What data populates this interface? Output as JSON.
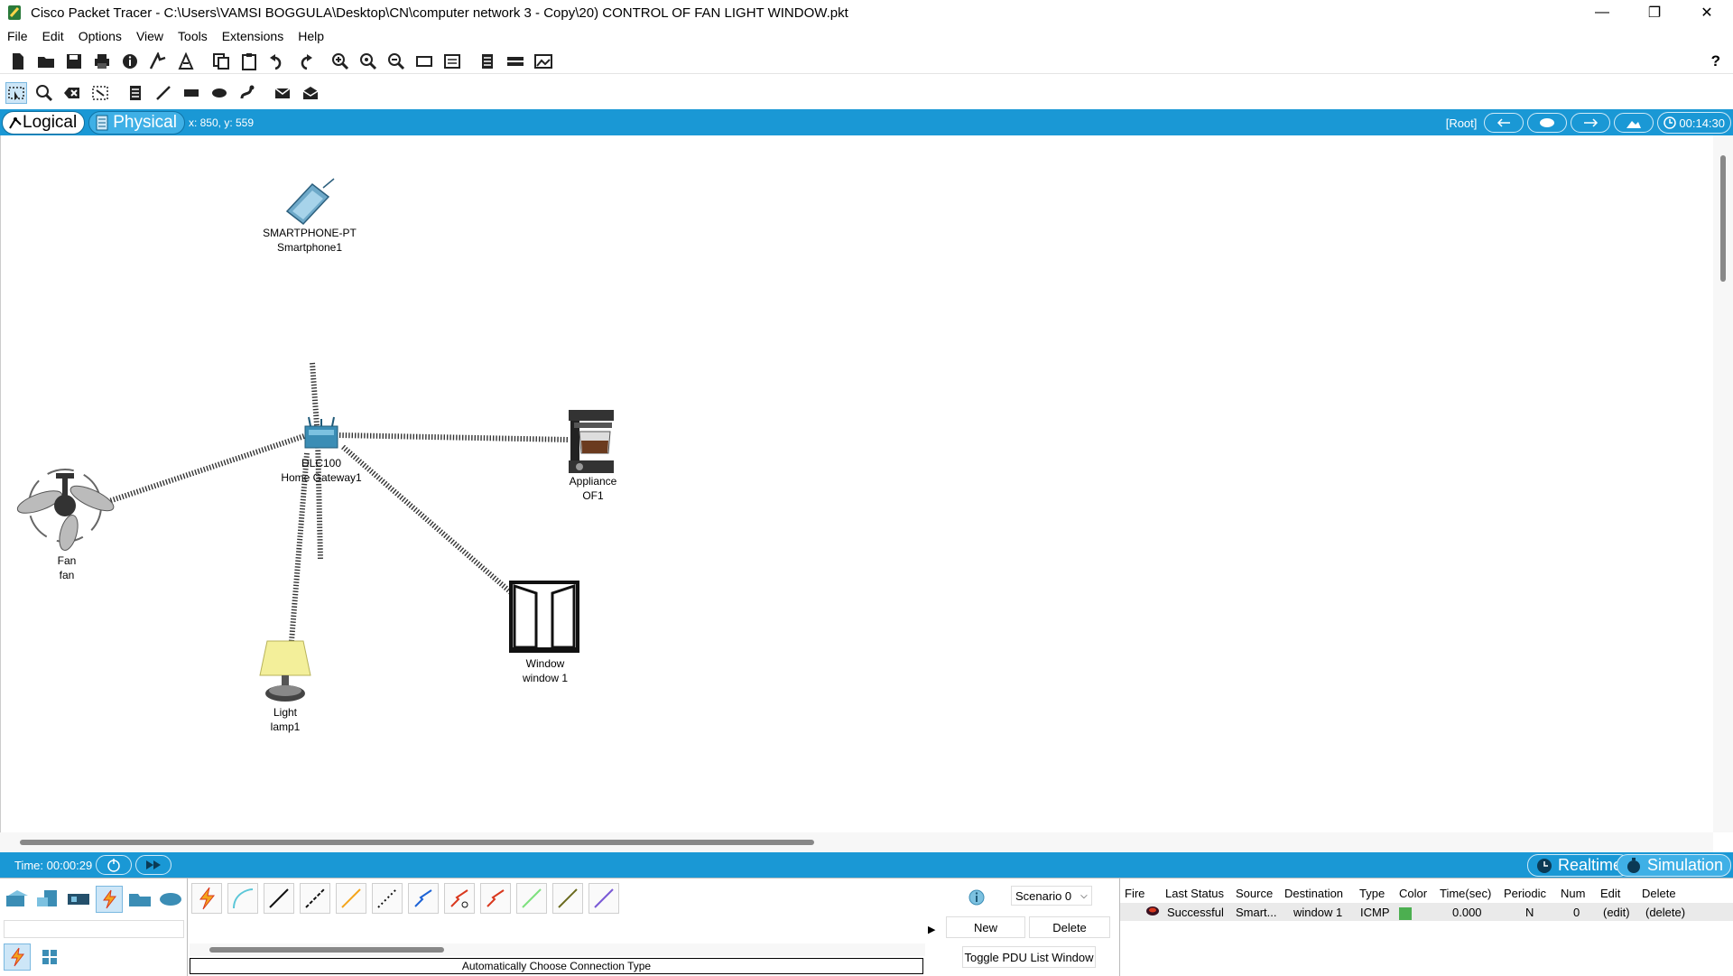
{
  "window": {
    "title": "Cisco Packet Tracer - C:\\Users\\VAMSI BOGGULA\\Desktop\\CN\\computer network 3 - Copy\\20) CONTROL OF FAN LIGHT WINDOW.pkt",
    "minimize": "—",
    "restore": "❐",
    "close": "✕"
  },
  "menu": [
    "File",
    "Edit",
    "Options",
    "View",
    "Tools",
    "Extensions",
    "Help"
  ],
  "toolbar": {
    "help": "?"
  },
  "modebar": {
    "logical": "Logical",
    "physical": "Physical",
    "coords": "x: 850, y: 559",
    "root": "[Root]",
    "clock": "00:14:30"
  },
  "devices": {
    "smartphone": {
      "model": "SMARTPHONE-PT",
      "name": "Smartphone1"
    },
    "gateway": {
      "model": "DLC100",
      "name": "Home Gateway1"
    },
    "appliance": {
      "model": "Appliance",
      "name": "OF1"
    },
    "fan": {
      "model": "Fan",
      "name": "fan"
    },
    "window": {
      "model": "Window",
      "name": "window 1"
    },
    "light": {
      "model": "Light",
      "name": "lamp1"
    }
  },
  "timebar": {
    "time": "Time: 00:00:29",
    "realtime": "Realtime",
    "simulation": "Simulation"
  },
  "connections": {
    "status": "Automatically Choose Connection Type"
  },
  "scenario": {
    "selected": "Scenario 0",
    "new": "New",
    "delete": "Delete",
    "toggle": "Toggle PDU List Window"
  },
  "pdu": {
    "headers": [
      "Fire",
      "Last Status",
      "Source",
      "Destination",
      "Type",
      "Color",
      "Time(sec)",
      "Periodic",
      "Num",
      "Edit",
      "Delete"
    ],
    "rows": [
      {
        "status": "Successful",
        "source": "Smart...",
        "destination": "window 1",
        "type": "ICMP",
        "color": "#4caf50",
        "time": "0.000",
        "periodic": "N",
        "num": "0",
        "edit": "(edit)",
        "delete": "(delete)"
      }
    ]
  },
  "colors": {
    "accent": "#1a98d5",
    "link": "#333333"
  }
}
